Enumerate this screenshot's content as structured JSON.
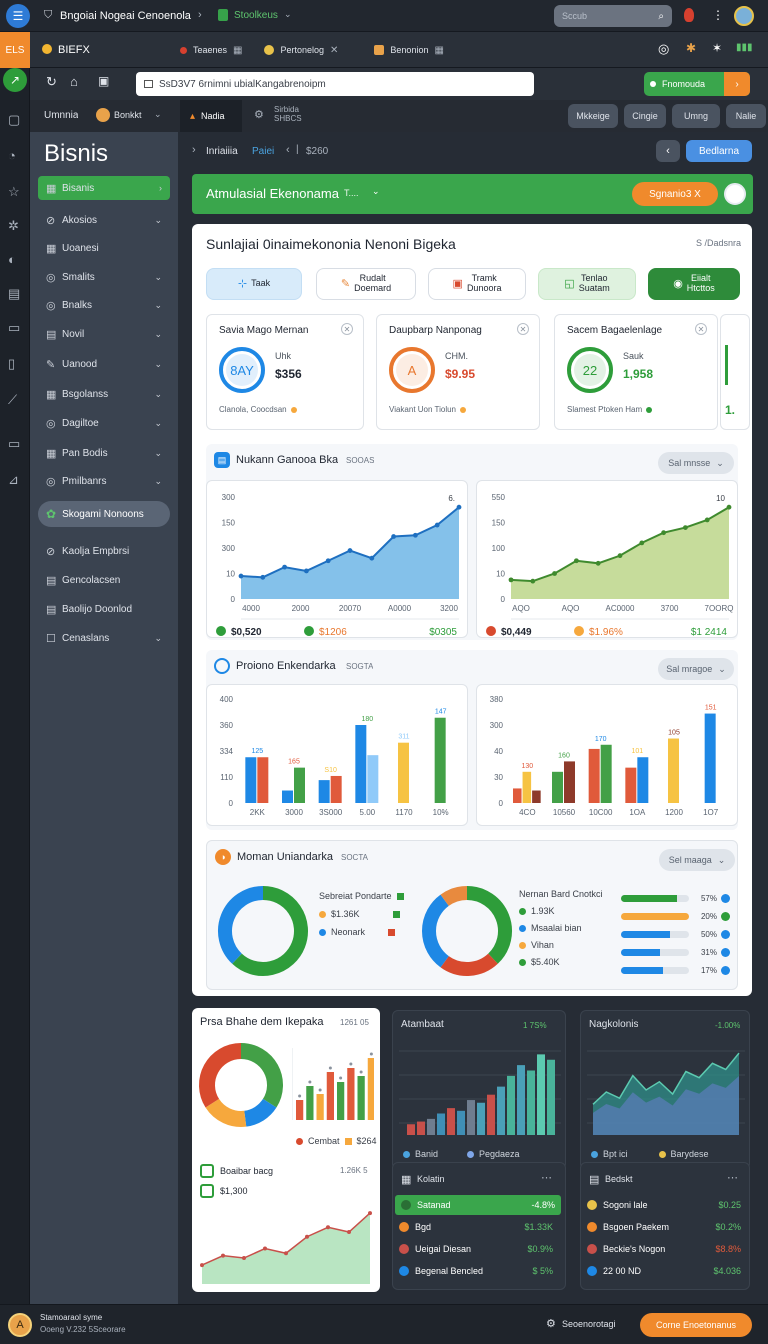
{
  "topbar": {
    "app_name": "Bngoiai Nogeai Cenoenola",
    "workspace": "Stoolkeus",
    "search_placeholder": "Sccub"
  },
  "toolbar": {
    "badge": "ELS",
    "brand": "BIEFX",
    "tabs": [
      "Teaenes",
      "Pertonelog",
      "Benonion"
    ]
  },
  "address": {
    "url": "SsD3V7 6rnimni ubialKangabrenoipm",
    "button_label": "Fnomouda"
  },
  "subnav": {
    "left_label": "Umnnia",
    "account": "Bonkkt",
    "tab_active": "Nadia",
    "tab_info": "Sirbida\nSHBCS",
    "right_buttons": [
      "Mkkeige",
      "Cingie",
      "Umng",
      "Nalie"
    ]
  },
  "sidebar": {
    "title": "Bisnis",
    "items": [
      {
        "label": "Bisanis",
        "icon": "grid-icon",
        "active": true,
        "chevron": "right"
      },
      {
        "label": "Akosios",
        "icon": "link-icon",
        "chevron": "down"
      },
      {
        "label": "Uoanesi",
        "icon": "grid-icon",
        "chevron": ""
      },
      {
        "label": "Smalits",
        "icon": "circle-icon",
        "chevron": "down"
      },
      {
        "label": "Bnalks",
        "icon": "circle-icon",
        "chevron": "down"
      },
      {
        "label": "Novil",
        "icon": "doc-icon",
        "chevron": "down"
      },
      {
        "label": "Uanood",
        "icon": "pen-icon",
        "chevron": "down"
      },
      {
        "label": "Bsgolanss",
        "icon": "grid-icon",
        "chevron": "down"
      },
      {
        "label": "Dagiltoe",
        "icon": "circle-icon",
        "chevron": "down"
      },
      {
        "label": "Pan Bodis",
        "icon": "grid-icon",
        "chevron": "down"
      },
      {
        "label": "Pmilbanrs",
        "icon": "circle-icon",
        "chevron": "down"
      }
    ],
    "highlight": "Skogami Nonoons",
    "extra": [
      {
        "label": "Kaolja Empbrsi",
        "icon": "link-icon",
        "chevron": ""
      },
      {
        "label": "Gencolacsen",
        "icon": "doc-icon",
        "chevron": ""
      },
      {
        "label": "Baolijo Doonlod",
        "icon": "doc-icon",
        "chevron": ""
      },
      {
        "label": "Cenaslans",
        "icon": "square-icon",
        "chevron": "down"
      }
    ]
  },
  "breadcrumb": {
    "items": [
      "Inriaiiia",
      "Paiei"
    ],
    "extra": "$260",
    "button": "Bedlarna"
  },
  "banner": {
    "title": "Atmulasial Ekenonama",
    "sub": "T....",
    "button": "Sgnanio3 X"
  },
  "summary": {
    "title": "Sunlajiai 0inaimekononia Nenoni Bigeka",
    "meta": "S /Dadsnra",
    "chips": [
      {
        "label": "Taak",
        "sub": ""
      },
      {
        "label": "Rudalt",
        "sub": "Doemard"
      },
      {
        "label": "Tramk",
        "sub": "Dunoora"
      },
      {
        "label": "Tenlao",
        "sub": "Suatam"
      },
      {
        "label": "Eiialt",
        "sub": "Htcttos"
      }
    ]
  },
  "metrics": [
    {
      "title": "Savia Mago Mernan",
      "ring": "8AY",
      "caption": "Uhk",
      "value": "$356",
      "foot": "Clanola, Coocdsan",
      "color": "#1e88e5"
    },
    {
      "title": "Daupbarp Nanponag",
      "ring": "A",
      "caption": "CHM.",
      "value": "$9.95",
      "foot": "Viakant Uon Tiolun",
      "color": "#e8772e"
    },
    {
      "title": "Sacem Bagaelenlage",
      "ring": "22",
      "caption": "Sauk",
      "value": "1,958",
      "foot": "Slamest Ptoken Ham",
      "color": "#2e9d3a"
    },
    {
      "title": "",
      "ring": "",
      "caption": "",
      "value": "1.",
      "foot": "",
      "color": "#2e9d3a"
    }
  ],
  "panel_line": {
    "title": "Nukann Ganooa Bka",
    "meta": "SOOAS",
    "select": "Sal mnsse"
  },
  "panel_bar": {
    "title": "Proiono Enkendarka",
    "meta": "SOGTA",
    "select": "Sal mragoe"
  },
  "panel_donut": {
    "title": "Moman Uniandarka",
    "meta": "SOCTA",
    "select": "Sel maaga",
    "legend_a": [
      "Sebreiat Pondarte",
      "$1.36K",
      "Neonark"
    ],
    "legend_b": [
      "Nernan Bard Cnotkci",
      "1.93K",
      "Msaalai bian",
      "Vihan",
      "$5.40K"
    ],
    "progress_labels": [
      "57%",
      "20%",
      "50%",
      "31%",
      "17%"
    ]
  },
  "chart_data": [
    {
      "type": "area",
      "id": "line-left",
      "categories": [
        "4000",
        "2000",
        "20070",
        "A0000",
        "3200"
      ],
      "yticks": [
        "300",
        "150",
        "300",
        "10",
        "0"
      ],
      "values": [
        18,
        17,
        25,
        22,
        30,
        38,
        32,
        49,
        50,
        58,
        72
      ],
      "ylim": [
        0,
        80
      ],
      "peak_label": "6.",
      "foot": [
        "$0,520",
        "$1206",
        "$0305"
      ],
      "color": "#4aa3df"
    },
    {
      "type": "area",
      "id": "line-right",
      "categories": [
        "AQO",
        "AQO",
        "AC0000",
        "3700",
        "7OORQ"
      ],
      "yticks": [
        "550",
        "150",
        "100",
        "10",
        "0"
      ],
      "values": [
        15,
        14,
        20,
        30,
        28,
        34,
        44,
        52,
        56,
        62,
        72
      ],
      "ylim": [
        0,
        80
      ],
      "peak_label": "10",
      "foot": [
        "$0,449",
        "$1.96%",
        "$1 2414"
      ],
      "color": "#9ac456"
    },
    {
      "type": "bar",
      "id": "bar-left",
      "categories": [
        "2KK",
        "3000",
        "3S000",
        "5.00",
        "1170",
        "10%"
      ],
      "yticks": [
        "400",
        "360",
        "334",
        "110",
        "0"
      ],
      "series": [
        {
          "color": "#1e88e5",
          "values": [
            44,
            12,
            22,
            75,
            0,
            0
          ]
        },
        {
          "color": "#e05a3b",
          "values": [
            44,
            0,
            26,
            0,
            0,
            0
          ]
        },
        {
          "color": "#f6c343",
          "values": [
            0,
            0,
            0,
            0,
            58,
            0
          ]
        },
        {
          "color": "#43a047",
          "values": [
            0,
            34,
            0,
            0,
            0,
            82
          ]
        },
        {
          "color": "#90caf9",
          "values": [
            0,
            0,
            0,
            46,
            0,
            0
          ]
        }
      ],
      "labels": [
        "125",
        "165",
        "S10",
        "180",
        "311",
        "147"
      ],
      "ylim": [
        0,
        100
      ]
    },
    {
      "type": "bar",
      "id": "bar-right",
      "categories": [
        "4CO",
        "10560",
        "10C00",
        "1OA",
        "1200",
        "1O7"
      ],
      "yticks": [
        "380",
        "300",
        "40",
        "30",
        "0"
      ],
      "series": [
        {
          "color": "#e05a3b",
          "values": [
            14,
            0,
            52,
            34,
            0,
            0
          ]
        },
        {
          "color": "#43a047",
          "values": [
            0,
            30,
            56,
            0,
            0,
            0
          ]
        },
        {
          "color": "#1e88e5",
          "values": [
            0,
            0,
            0,
            44,
            0,
            86
          ]
        },
        {
          "color": "#f6c343",
          "values": [
            30,
            0,
            0,
            0,
            62,
            0
          ]
        },
        {
          "color": "#8e3a2a",
          "values": [
            12,
            40,
            0,
            0,
            0,
            0
          ]
        }
      ],
      "labels": [
        "130",
        "160",
        "170",
        "101",
        "105",
        "151"
      ],
      "ylim": [
        0,
        100
      ]
    },
    {
      "type": "pie",
      "id": "donut-a",
      "values": [
        62,
        38
      ],
      "colors": [
        "#2e9d3a",
        "#1e88e5"
      ]
    },
    {
      "type": "pie",
      "id": "donut-b",
      "values": [
        38,
        22,
        30,
        10
      ],
      "colors": [
        "#2e9d3a",
        "#d84a2e",
        "#1e88e5",
        "#e88a3e"
      ]
    },
    {
      "type": "pie",
      "id": "donut-c",
      "values": [
        34,
        14,
        18,
        34
      ],
      "colors": [
        "#43a047",
        "#1e88e5",
        "#f6a83d",
        "#d84a2e"
      ]
    },
    {
      "type": "bar",
      "id": "mini-bars",
      "values": [
        20,
        34,
        26,
        48,
        38,
        52,
        44,
        62
      ],
      "colors": [
        "#e05a3b",
        "#43a047",
        "#f6a83d",
        "#e05a3b",
        "#43a047",
        "#e05a3b",
        "#43a047",
        "#f6a83d"
      ]
    },
    {
      "type": "area",
      "id": "bottom-line",
      "values": [
        16,
        24,
        22,
        30,
        26,
        40,
        48,
        44,
        60
      ],
      "color": "#7fcf8f"
    },
    {
      "type": "bar",
      "id": "dark-bars",
      "values": [
        8,
        10,
        12,
        16,
        20,
        18,
        26,
        24,
        30,
        36,
        44,
        52,
        48,
        60,
        56
      ],
      "colors": [
        "#c8504a",
        "#c8504a",
        "#6f7d8f",
        "#3f8fb6",
        "#c8504a",
        "#3f8fb6",
        "#6f7d8f",
        "#4aa0b8",
        "#c8504a",
        "#4aa0b8",
        "#49b39a",
        "#4aa0b8",
        "#49b39a",
        "#5ccab0",
        "#49b39a"
      ]
    },
    {
      "type": "area",
      "id": "dark-area",
      "values": [
        30,
        42,
        36,
        58,
        44,
        52,
        40,
        62,
        56,
        70,
        64,
        80
      ]
    }
  ],
  "bottom_white": {
    "title": "Prsa Bhahe dem Ikepaka",
    "meta": "1261 05",
    "legend": [
      "Cembat",
      "$264"
    ],
    "sub_title": "Boaibar bacg",
    "sub_meta": "1.26K 5",
    "sub_value": "$1,300"
  },
  "dark_panels": {
    "left_title": "Atambaat",
    "left_meta": "1 7S%",
    "left_legend": [
      "Banid",
      "Pegdaeza"
    ],
    "right_title": "Nagkolonis",
    "right_meta": "-1.00%",
    "right_legend": [
      "Bpt ici",
      "Barydese"
    ],
    "list_left_title": "Kolatin",
    "list_left": [
      {
        "label": "Satanad",
        "value": "-4.8%",
        "active": true
      },
      {
        "label": "Bgd",
        "value": "$1.33K"
      },
      {
        "label": "Ueigai Diesan",
        "value": "$0.9%"
      },
      {
        "label": "Begenal Bencled",
        "value": "$ 5%"
      }
    ],
    "list_right_title": "Bedskt",
    "list_right": [
      {
        "label": "Sogoni lale",
        "value": "$0.25"
      },
      {
        "label": "Bsgoen Paekem",
        "value": "$0.2%"
      },
      {
        "label": "Beckie's Nogon",
        "value": "$8.8%"
      },
      {
        "label": "22 00 ND",
        "value": "$4.036"
      }
    ]
  },
  "footer": {
    "user_line1": "Stamoaraol syme",
    "user_line2": "Ooeng V.232 5Sceorare",
    "status": "Seoenorotagi",
    "button": "Corne Enoetonanus"
  }
}
